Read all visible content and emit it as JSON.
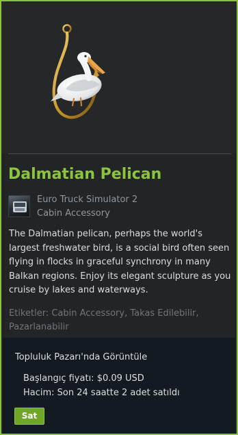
{
  "item": {
    "name": "Dalmatian Pelican",
    "game_name": "Euro Truck Simulator 2",
    "item_type": "Cabin Accessory",
    "description": "The Dalmatian pelican, perhaps the world's largest freshwater bird, is a social bird often seen flying in flocks in graceful synchrony in many Balkan regions. Enjoy its elegant sculpture as you cruise by lakes and waterways.",
    "tags": "Etiketler: Cabin Accessory, Takas Edilebilir, Pazarlanabilir"
  },
  "market": {
    "title": "Topluluk Pazarı'nda Görüntüle",
    "starting_price": "Başlangıç fiyatı: $0.09 USD",
    "volume": "Hacim: Son 24 saatte 2 adet satıldı",
    "sell_label": "Sat"
  },
  "icons": {
    "item_image": "pelican-hook-ornament-icon",
    "game_icon": "truck-game-icon"
  },
  "colors": {
    "accent": "#8bc53f",
    "sell_button": "#6fa628",
    "panel": "#232425",
    "market_panel": "#141a22"
  }
}
